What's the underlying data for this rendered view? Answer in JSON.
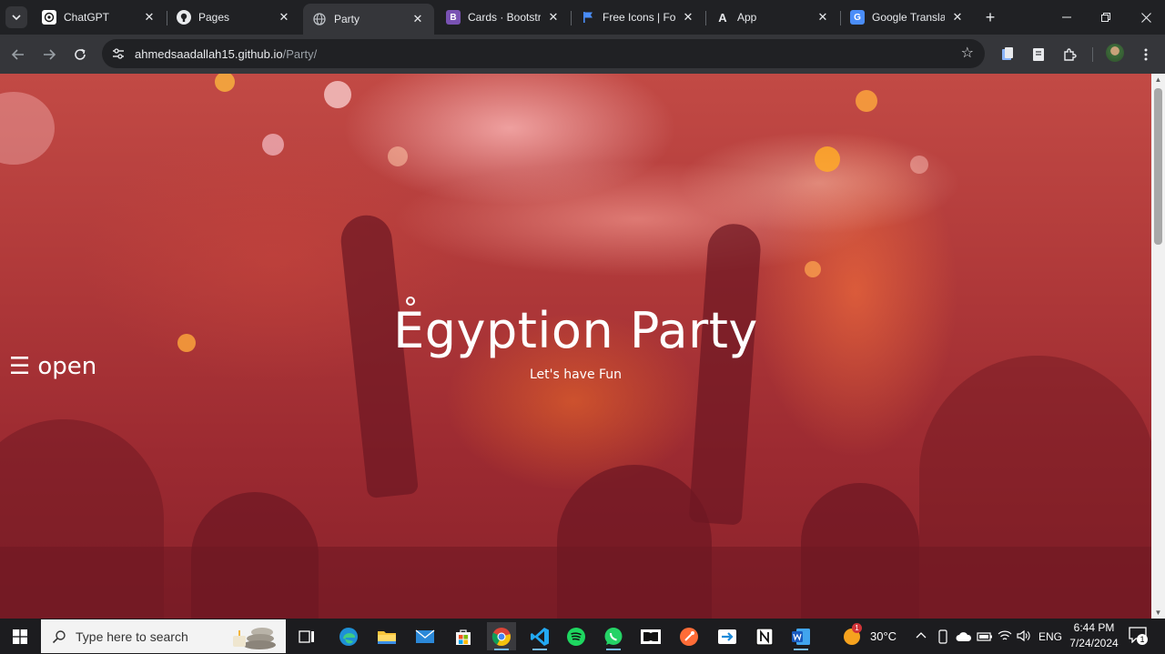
{
  "tabs": [
    {
      "title": "ChatGPT",
      "icon": "chatgpt-icon",
      "active": false
    },
    {
      "title": "Pages",
      "icon": "github-icon",
      "active": false
    },
    {
      "title": "Party",
      "icon": "globe-icon",
      "active": true
    },
    {
      "title": "Cards · Bootstrap",
      "icon": "bootstrap-icon",
      "active": false
    },
    {
      "title": "Free Icons | Font",
      "icon": "flag-icon",
      "active": false
    },
    {
      "title": "App",
      "icon": "a-logo-icon",
      "active": false
    },
    {
      "title": "Google Translate",
      "icon": "translate-icon",
      "active": false
    }
  ],
  "omnibox": {
    "host": "ahmedsaadallah15.github.io",
    "path": "/Party/"
  },
  "page": {
    "title": "Egyption Party",
    "subtitle": "Let's have Fun",
    "open_button": "open",
    "burger_glyph": "☰"
  },
  "taskbar": {
    "search_placeholder": "Type here to search",
    "weather_temp": "30°C",
    "weather_badge": "1",
    "language": "ENG",
    "time": "6:44 PM",
    "date": "7/24/2024",
    "notification_count": "1",
    "apps": [
      "task-view-icon",
      "edge-icon",
      "file-explorer-icon",
      "mail-icon",
      "store-icon",
      "chrome-icon",
      "vscode-icon",
      "spotify-icon",
      "whatsapp-icon",
      "dolby-icon",
      "postman-icon",
      "sync-icon",
      "notion-icon",
      "word-icon"
    ]
  },
  "colors": {
    "hero_overlay": "#b13a3a",
    "chrome_dark": "#202124",
    "chrome_toolbar": "#35363a"
  }
}
